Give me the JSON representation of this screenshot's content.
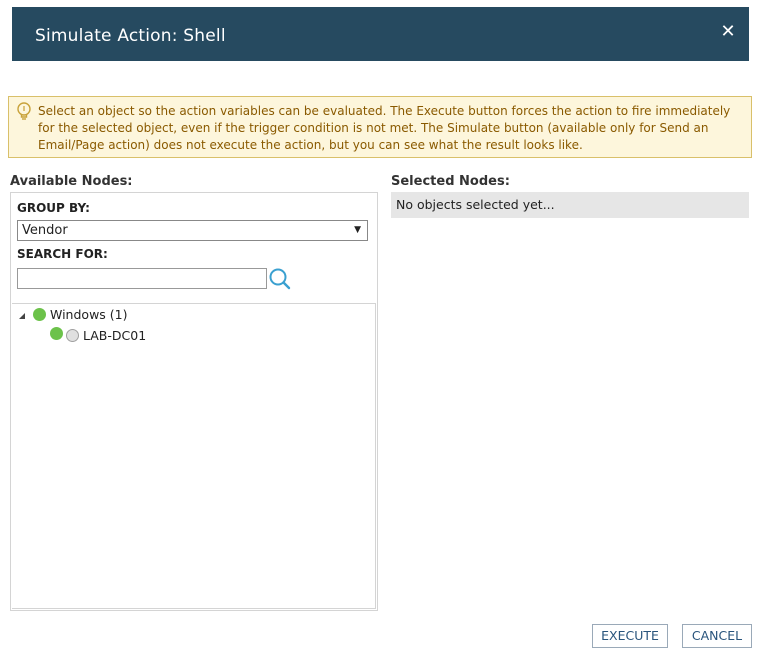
{
  "dialog": {
    "title": "Simulate Action: Shell",
    "close_icon": "close-icon"
  },
  "hint": {
    "icon": "lightbulb-icon",
    "text": "Select an object so the action variables can be evaluated. The Execute button forces the action to fire immediately for the selected object, even if the trigger condition is not met. The Simulate button (available only for Send an Email/Page action) does not execute the action, but you can see what the result looks like."
  },
  "available": {
    "heading": "Available Nodes:",
    "group_by_label": "GROUP BY:",
    "group_by_value": "Vendor",
    "search_label": "SEARCH FOR:",
    "search_value": "",
    "search_icon": "search-icon",
    "tree": {
      "group": {
        "label": "Windows (1)",
        "status_color": "#6cc24a",
        "expanded": true
      },
      "items": [
        {
          "label": "LAB-DC01",
          "status_color": "#6cc24a",
          "selected": false
        }
      ]
    }
  },
  "selected": {
    "heading": "Selected Nodes:",
    "empty_text": "No objects selected yet..."
  },
  "buttons": {
    "execute": "EXECUTE",
    "cancel": "CANCEL"
  },
  "colors": {
    "titlebar": "#264a60",
    "hint_bg": "#fdf6dc",
    "hint_text": "#8a5a00",
    "button_text": "#29547c"
  }
}
